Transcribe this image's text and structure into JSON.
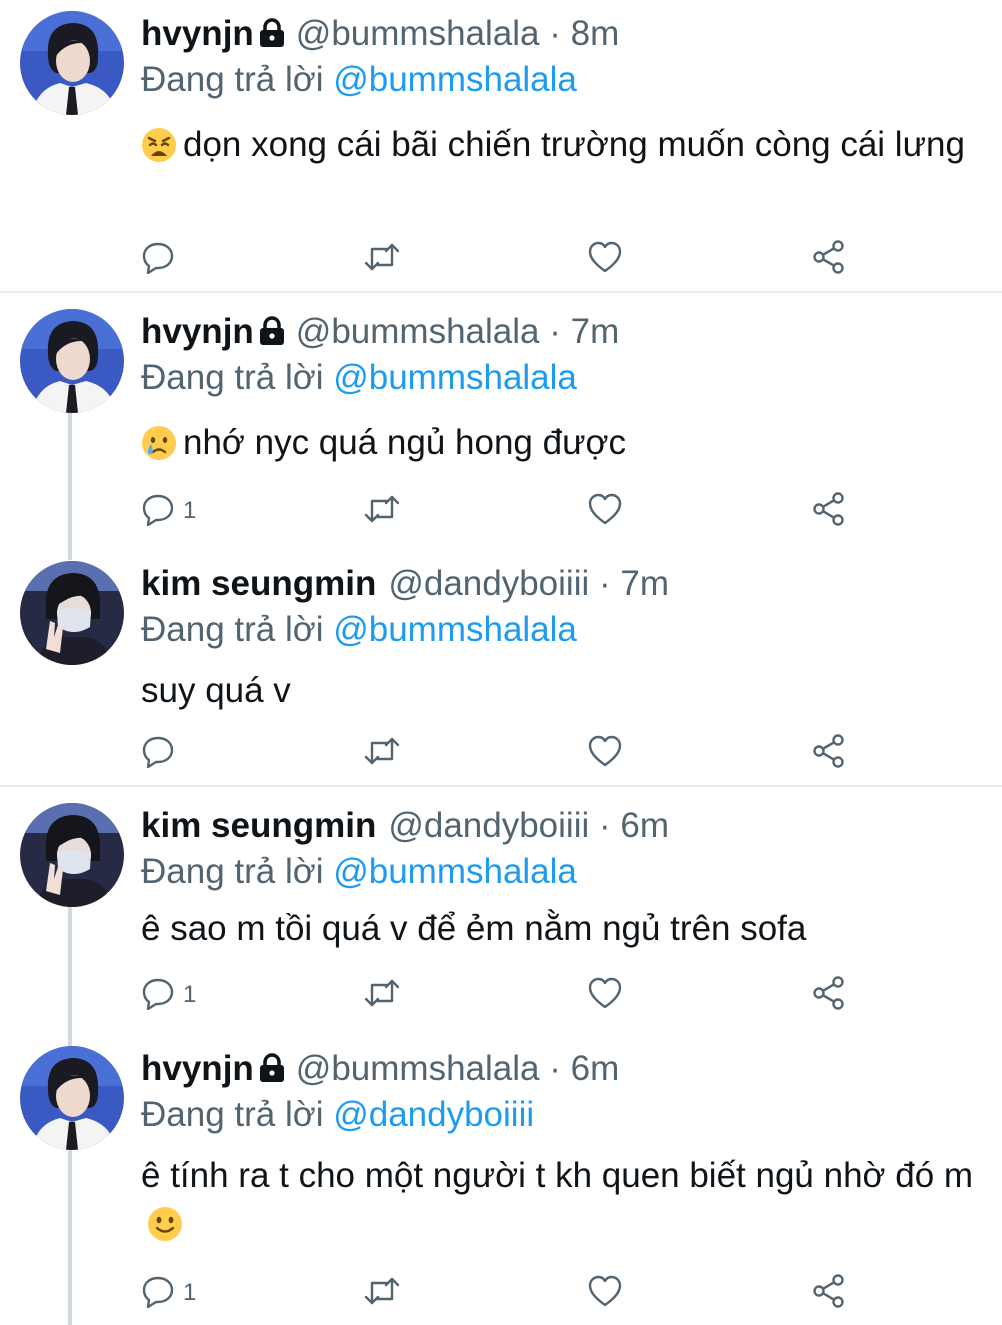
{
  "tweets": [
    {
      "name": "hvynjn",
      "locked": true,
      "handle": "@bummshalala",
      "separator": "·",
      "time": "8m",
      "replying_prefix": "Đang trả lời",
      "replying_to": "@bummshalala",
      "text": "dọn xong cái bãi chiến trường muốn còng cái lưng",
      "emoji": "weary-face",
      "reply_count": ""
    },
    {
      "name": "hvynjn",
      "locked": true,
      "handle": "@bummshalala",
      "separator": "·",
      "time": "7m",
      "replying_prefix": "Đang trả lời",
      "replying_to": "@bummshalala",
      "text": "nhớ nyc quá ngủ hong được",
      "emoji": "crying-face",
      "reply_count": "1"
    },
    {
      "name": "kim seungmin",
      "locked": false,
      "handle": "@dandyboiiii",
      "separator": "·",
      "time": "7m",
      "replying_prefix": "Đang trả lời",
      "replying_to": "@bummshalala",
      "text": "suy quá v",
      "reply_count": ""
    },
    {
      "name": "kim seungmin",
      "locked": false,
      "handle": "@dandyboiiii",
      "separator": "·",
      "time": "6m",
      "replying_prefix": "Đang trả lời",
      "replying_to": "@bummshalala",
      "text": "ê sao m tồi quá v để ẻm nằm ngủ trên sofa",
      "reply_count": "1"
    },
    {
      "name": "hvynjn",
      "locked": true,
      "handle": "@bummshalala",
      "separator": "·",
      "time": "6m",
      "replying_prefix": "Đang trả lời",
      "replying_to": "@dandyboiiii",
      "text": "ê tính ra t cho một người t kh quen biết ngủ nhờ đó m",
      "emoji": "slightly-smiling-face",
      "reply_count": "1"
    }
  ],
  "icons": {
    "reply": "reply-icon",
    "retweet": "retweet-icon",
    "like": "heart-icon",
    "share": "share-icon",
    "lock": "lock-icon"
  },
  "colors": {
    "text": "#0f1419",
    "secondary": "#536471",
    "accent": "#1d9bf0",
    "divider": "#e6ecf0",
    "thread_line": "#cfd9de"
  }
}
